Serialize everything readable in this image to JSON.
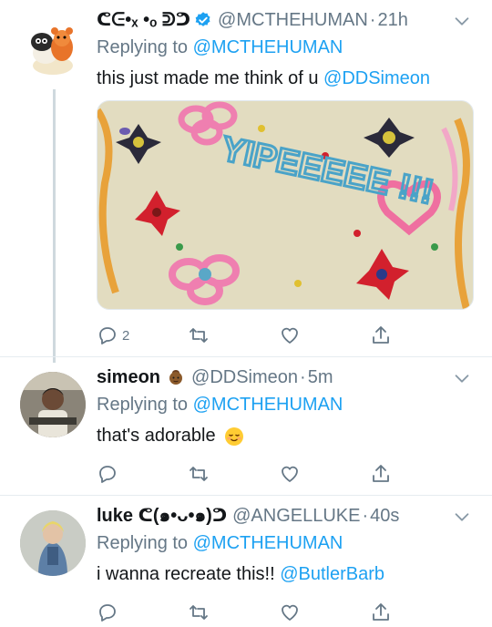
{
  "tweets": [
    {
      "name": "ᕦᕮ•ₓ •ₒ ᕲᕤ",
      "handle": "@MCTHEHUMAN",
      "time": "21h",
      "replying_prefix": "Replying to",
      "replying_to": "@MCTHEHUMAN",
      "text": "this just made me think of u",
      "mention": "@DDSimeon",
      "cake_text": "YIPEEEEE !!!",
      "reply_count": "2"
    },
    {
      "name": "simeon",
      "handle": "@DDSimeon",
      "time": "5m",
      "replying_prefix": "Replying to",
      "replying_to": "@MCTHEHUMAN",
      "text": "that's adorable"
    },
    {
      "name": "luke ᕦ(๑•ᴗ•๑)ᕤ",
      "handle": "@ANGELLUKE",
      "time": "40s",
      "replying_prefix": "Replying to",
      "replying_to": "@MCTHEHUMAN",
      "text": "i wanna recreate this!!",
      "mention": "@ButlerBarb"
    }
  ],
  "icons": {
    "reply": "reply-icon",
    "retweet": "retweet-icon",
    "like": "heart-icon",
    "share": "share-icon",
    "more": "chevron-down-icon",
    "verified": "verified-badge-icon"
  },
  "colors": {
    "link": "#1da1f2",
    "secondary": "#657786",
    "icon": "#657786"
  }
}
